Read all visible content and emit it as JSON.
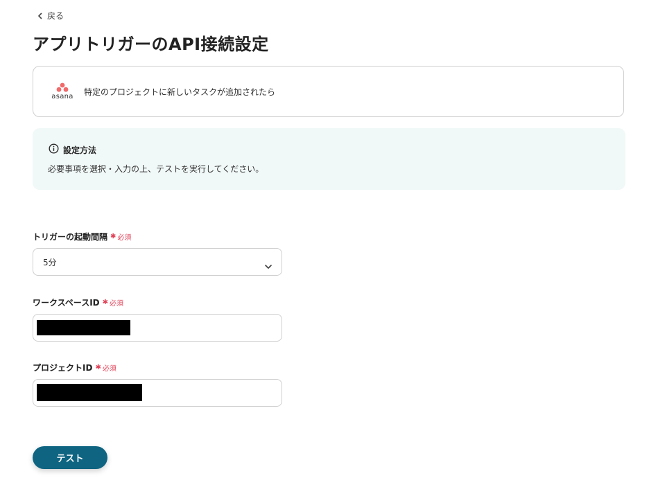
{
  "nav": {
    "back_label": "戻る"
  },
  "page": {
    "title": "アプリトリガーのAPI接続設定"
  },
  "trigger": {
    "app_name": "asana",
    "label": "特定のプロジェクトに新しいタスクが追加されたら",
    "logo_color": "#f06a6a"
  },
  "info": {
    "heading": "設定方法",
    "text": "必要事項を選択・入力の上、テストを実行してください。"
  },
  "fields": [
    {
      "label": "トリガーの起動間隔",
      "required": "必須",
      "type": "select",
      "value": "5分"
    },
    {
      "label": "ワークスペースID",
      "required": "必須",
      "type": "text",
      "value_redacted": true
    },
    {
      "label": "プロジェクトID",
      "required": "必須",
      "type": "text",
      "value_redacted": true
    }
  ],
  "actions": {
    "test_label": "テスト",
    "button_color": "#0e6481"
  },
  "colors": {
    "required": "#e0445a",
    "info_bg": "#f1f9f8"
  },
  "icons": {
    "back": "chevron-left-icon",
    "info": "info-circle-icon",
    "dropdown": "chevron-down-icon",
    "required": "asterisk-icon"
  }
}
